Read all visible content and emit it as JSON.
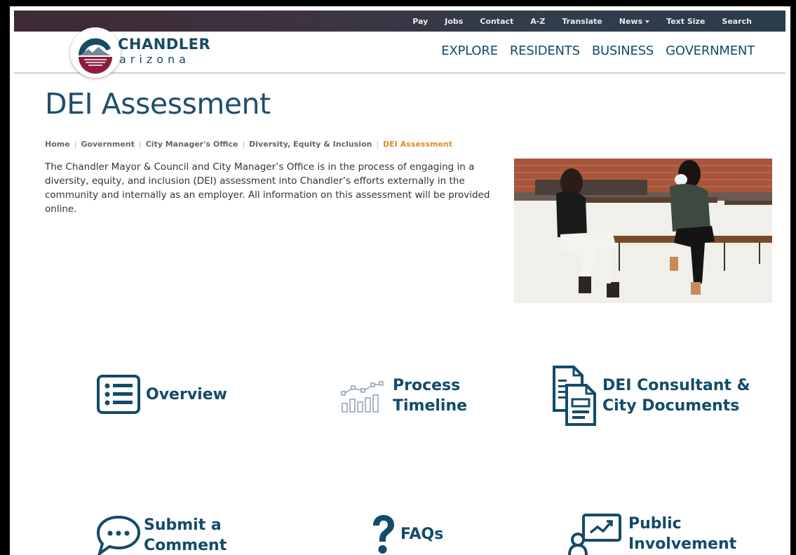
{
  "utility_nav": {
    "items": [
      "Pay",
      "Jobs",
      "Contact",
      "A-Z",
      "Translate"
    ],
    "news_label": "News",
    "text_size": "Text Size",
    "search": "Search"
  },
  "header": {
    "logo_word": "CHANDLER",
    "logo_sub": "arizona",
    "nav": [
      "EXPLORE",
      "RESIDENTS",
      "BUSINESS",
      "GOVERNMENT"
    ]
  },
  "page": {
    "title": "DEI Assessment",
    "breadcrumb": [
      "Home",
      "Government",
      "City Manager's Office",
      "Diversity, Equity & Inclusion"
    ],
    "breadcrumb_current": "DEI Assessment",
    "intro": "The Chandler Mayor & Council and City Manager’s Office is in the process of engaging in a diversity, equity, and inclusion (DEI) assessment into Chandler’s efforts externally in the community and internally as an employer. All information on this assessment will be provided online."
  },
  "quick_links": {
    "overview": [
      "Overview"
    ],
    "process_timeline": [
      "Process",
      "Timeline"
    ],
    "dei_documents": [
      "DEI Consultant &",
      "City Documents"
    ],
    "submit_comment": [
      "Submit a",
      "Comment"
    ],
    "faqs": [
      "FAQs"
    ],
    "public_involvement": [
      "Public",
      "Involvement"
    ]
  },
  "icons": {
    "overview": "list-icon",
    "process_timeline": "bar-line-chart-icon",
    "dei_documents": "documents-icon",
    "submit_comment": "chat-bubble-icon",
    "faqs": "question-mark-icon",
    "public_involvement": "presentation-icon"
  },
  "colors": {
    "brand_blue": "#134b6b",
    "accent_orange": "#e08a2c",
    "logo_maroon": "#8c1d3f"
  }
}
